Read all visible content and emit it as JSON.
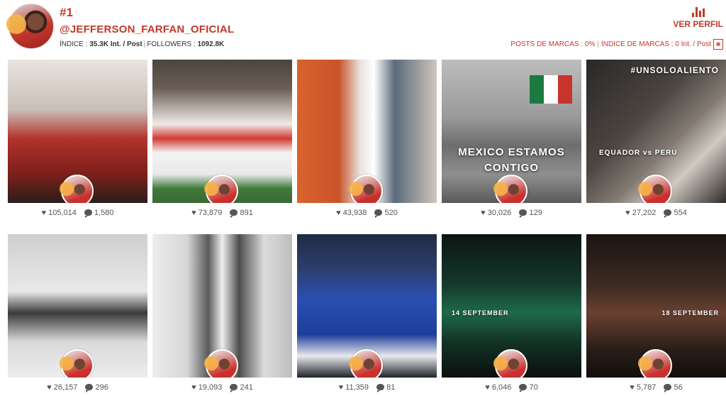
{
  "profile": {
    "rank": "#1",
    "handle": "@JEFFERSON_FARFAN_OFICIAL",
    "index_label": "ÍNDICE : ",
    "index_value": "35.3K Int. / Post",
    "followers_label": "FOLLOWERS : ",
    "followers_value": "1092.8K",
    "ver_perfil": "VER PERFIL",
    "brand_posts": "POSTS DE MARCAS : 0%",
    "brand_index": "ÍNDICE DE MARCAS : 0 Int. / Post"
  },
  "icons": {
    "likes": "heart-icon",
    "comments": "comment-bubble-icon",
    "ver_perfil": "bar-chart-icon",
    "pdf": "pdf-icon"
  },
  "posts": [
    {
      "likes": "105,014",
      "comments": "1,580"
    },
    {
      "likes": "73,879",
      "comments": "891"
    },
    {
      "likes": "43,938",
      "comments": "520"
    },
    {
      "likes": "30,026",
      "comments": "129",
      "overlay": "MEXICO ESTAMOS\nCONTIGO"
    },
    {
      "likes": "27,202",
      "comments": "554",
      "overlay": "#UNSOLOALIENTO",
      "overlay2": "EQUADOR vs PERU"
    },
    {
      "likes": "26,157",
      "comments": "296"
    },
    {
      "likes": "19,093",
      "comments": "241"
    },
    {
      "likes": "11,359",
      "comments": "81"
    },
    {
      "likes": "6,046",
      "comments": "70",
      "overlay": "14 SEPTEMBER"
    },
    {
      "likes": "5,787",
      "comments": "56",
      "overlay": "18 SEPTEMBER"
    }
  ],
  "colors": {
    "accent": "#c0392b"
  }
}
